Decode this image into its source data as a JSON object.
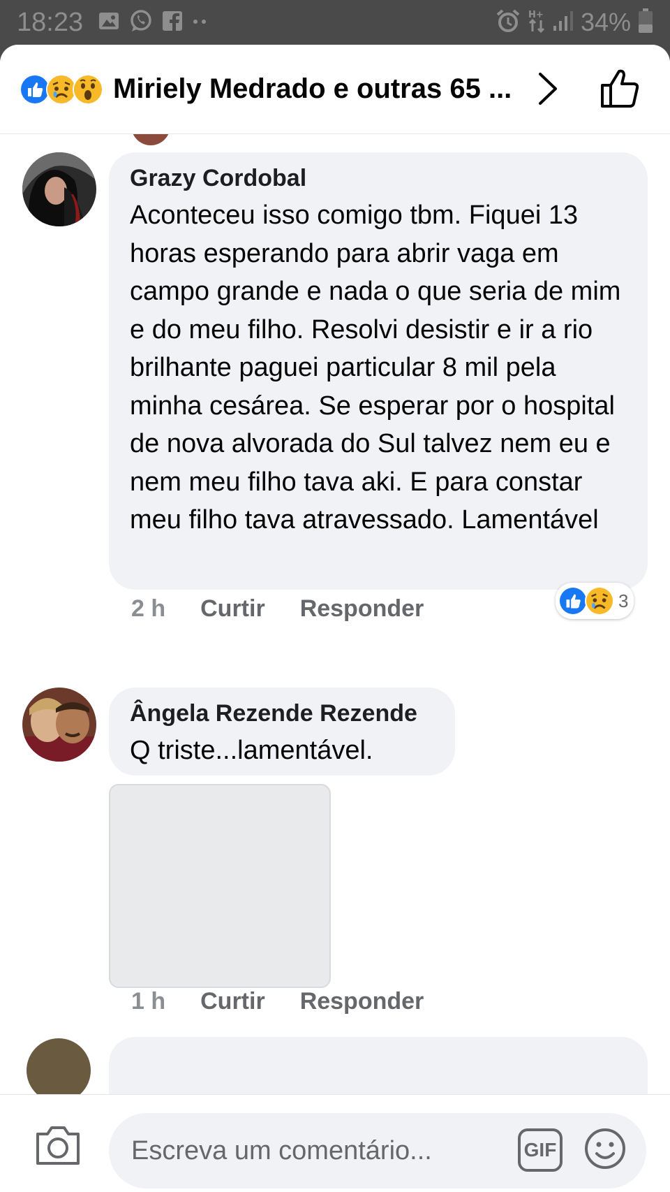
{
  "status_bar": {
    "time": "18:23",
    "battery": "34%",
    "left_icons": [
      "image-icon",
      "whatsapp-icon",
      "facebook-icon",
      "more-dots-icon"
    ],
    "right_icons": [
      "alarm-icon",
      "data-arrows-icon",
      "signal-icon",
      "battery-icon"
    ]
  },
  "header": {
    "reactions": [
      "like",
      "sad",
      "wow"
    ],
    "title": "Miriely Medrado e outras 65 ..."
  },
  "comments": [
    {
      "author": "Grazy Cordobal",
      "text": "Aconteceu isso comigo tbm. Fiquei 13 horas esperando para abrir vaga em campo grande  e nada o que seria de mim e do meu filho. Resolvi desistir e ir a rio brilhante paguei particular 8 mil pela minha cesárea. Se  esperar por  o hospital  de nova alvorada do Sul  talvez  nem eu e nem meu filho tava aki. E para constar meu filho tava atravessado. Lamentável",
      "time": "2 h",
      "like_label": "Curtir",
      "reply_label": "Responder",
      "reactions": [
        "like",
        "sad"
      ],
      "reaction_count": "3"
    },
    {
      "author": "Ângela Rezende Rezende",
      "text": "Q triste...lamentável.",
      "time": "1 h",
      "like_label": "Curtir",
      "reply_label": "Responder"
    }
  ],
  "composer": {
    "placeholder": "Escreva um comentário...",
    "gif_label": "GIF"
  },
  "colors": {
    "like_blue": "#1877f2",
    "sad_yellow": "#f7b928",
    "bubble_bg": "#f0f2f5",
    "meta_gray": "#65676b"
  }
}
